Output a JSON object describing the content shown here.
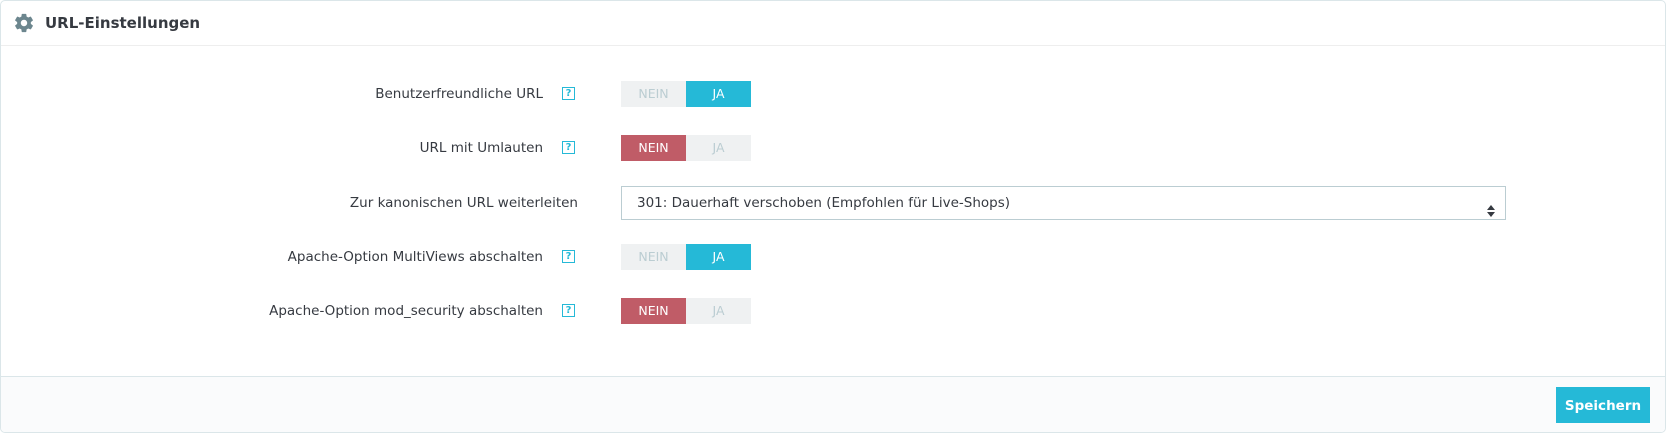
{
  "panel": {
    "title": "URL-Einstellungen",
    "icon": "gear-icon"
  },
  "settings": [
    {
      "label": "Benutzerfreundliche URL",
      "help": "?",
      "type": "toggle",
      "no": "NEIN",
      "yes": "JA",
      "value": "yes"
    },
    {
      "label": "URL mit Umlauten",
      "help": "?",
      "type": "toggle",
      "no": "NEIN",
      "yes": "JA",
      "value": "no"
    },
    {
      "label": "Zur kanonischen URL weiterleiten",
      "type": "select",
      "selected": "301: Dauerhaft verschoben (Empfohlen für Live-Shops)"
    },
    {
      "label": "Apache-Option MultiViews abschalten",
      "help": "?",
      "type": "toggle",
      "no": "NEIN",
      "yes": "JA",
      "value": "yes"
    },
    {
      "label": "Apache-Option mod_security abschalten",
      "help": "?",
      "type": "toggle",
      "no": "NEIN",
      "yes": "JA",
      "value": "no"
    }
  ],
  "footer": {
    "save_label": "Speichern"
  },
  "colors": {
    "accent": "#25b9d7",
    "danger": "#c05c67",
    "toggle_bg": "#eff1f2"
  }
}
